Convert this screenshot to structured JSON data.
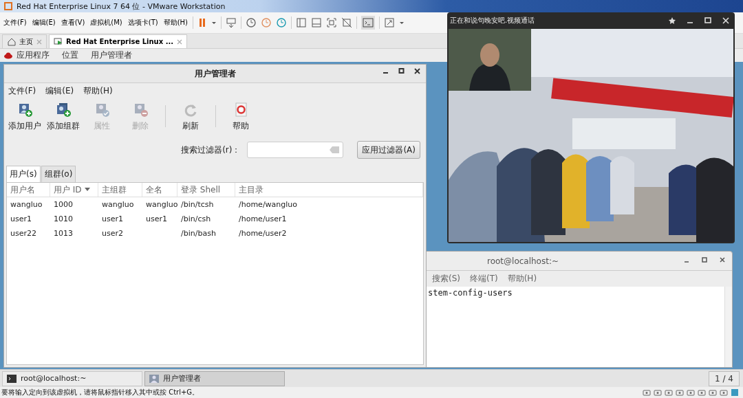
{
  "window": {
    "title": "Red Hat Enterprise Linux 7 64 位 - VMware Workstation"
  },
  "menu": [
    "文件(F)",
    "编辑(E)",
    "查看(V)",
    "虚拟机(M)",
    "选项卡(T)",
    "帮助(H)"
  ],
  "tabs": [
    {
      "label": "主页",
      "selected": false,
      "kind": "home"
    },
    {
      "label": "Red Hat Enterprise Linux ...",
      "selected": true,
      "kind": "vm"
    }
  ],
  "guest_panel": [
    "应用程序",
    "位置",
    "用户管理者"
  ],
  "user_manager": {
    "title": "用户管理者",
    "menu": [
      "文件(F)",
      "编辑(E)",
      "帮助(H)"
    ],
    "toolbar": [
      {
        "label": "添加用户",
        "kind": "add-user",
        "disabled": false
      },
      {
        "label": "添加组群",
        "kind": "add-group",
        "disabled": false
      },
      {
        "label": "属性",
        "kind": "properties",
        "disabled": true
      },
      {
        "label": "删除",
        "kind": "delete",
        "disabled": true
      },
      {
        "label": "刷新",
        "kind": "refresh",
        "disabled": false
      },
      {
        "label": "帮助",
        "kind": "help",
        "disabled": false
      }
    ],
    "filter_label": "搜索过滤器(r)：",
    "filter_button": "应用过滤器(A)",
    "tabs": [
      {
        "label": "用户(s)",
        "selected": true
      },
      {
        "label": "组群(o)",
        "selected": false
      }
    ],
    "columns": [
      {
        "label": "用户名",
        "sorted": false
      },
      {
        "label": "用户 ID",
        "sorted": true
      },
      {
        "label": "主组群",
        "sorted": false
      },
      {
        "label": "全名",
        "sorted": false
      },
      {
        "label": "登录 Shell",
        "sorted": false
      },
      {
        "label": "主目录",
        "sorted": false
      }
    ],
    "rows": [
      [
        "wangluo",
        "1000",
        "wangluo",
        "wangluo",
        "/bin/tcsh",
        "/home/wangluo"
      ],
      [
        "user1",
        "1010",
        "user1",
        "user1",
        "/bin/csh",
        "/home/user1"
      ],
      [
        "user22",
        "1013",
        "user2",
        "",
        "/bin/bash",
        "/home/user2"
      ]
    ]
  },
  "terminal": {
    "title": "root@localhost:~",
    "menu": [
      "搜索(S)",
      "终端(T)",
      "帮助(H)"
    ],
    "output": "stem-config-users"
  },
  "video_call": {
    "title": "正在和说句晚安吧.视频通话"
  },
  "guest_taskbar": {
    "items": [
      {
        "label": "root@localhost:~",
        "kind": "terminal",
        "selected": false
      },
      {
        "label": "用户管理者",
        "kind": "users",
        "selected": true
      }
    ],
    "workspace": "1 / 4"
  },
  "status_bar": {
    "message": "要将输入定向到该虚拟机，请将鼠标指针移入其中或按 Ctrl+G。"
  }
}
